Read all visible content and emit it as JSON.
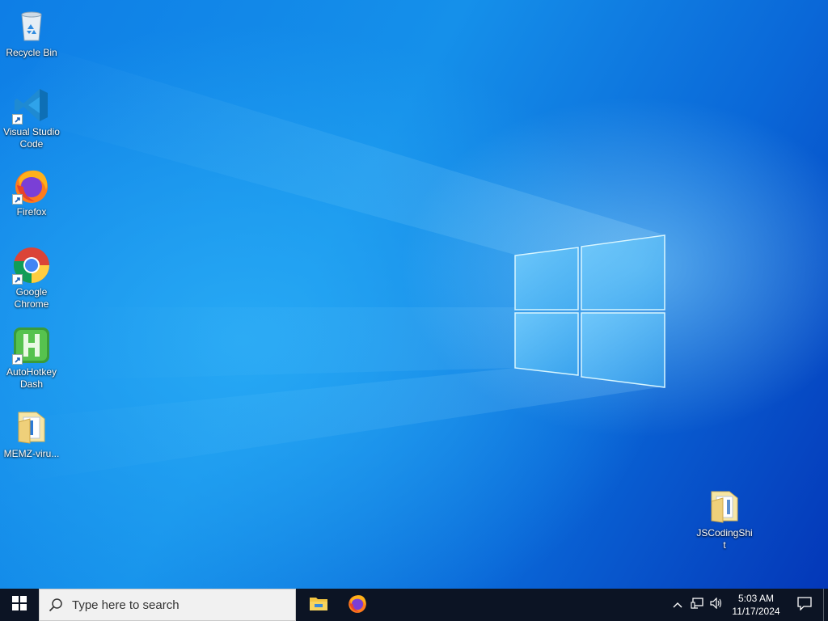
{
  "desktop": {
    "icons": [
      {
        "label": "Recycle Bin",
        "icon": "recycle-bin-icon"
      },
      {
        "label": "Visual Studio Code",
        "icon": "vscode-icon"
      },
      {
        "label": "Firefox",
        "icon": "firefox-icon"
      },
      {
        "label": "Google Chrome",
        "icon": "chrome-icon"
      },
      {
        "label": "AutoHotkey Dash",
        "icon": "autohotkey-icon"
      },
      {
        "label": "MEMZ-viru...",
        "icon": "folder-icon"
      },
      {
        "label": "JSCodingShit",
        "icon": "folder-icon"
      }
    ]
  },
  "taskbar": {
    "search_placeholder": "Type here to search",
    "pinned": [
      "file-explorer-icon",
      "firefox-icon"
    ],
    "clock_time": "5:03 AM",
    "clock_date": "11/17/2024"
  },
  "colors": {
    "wallpaper_accent": "#0a61d6",
    "taskbar": "#0c1424"
  }
}
